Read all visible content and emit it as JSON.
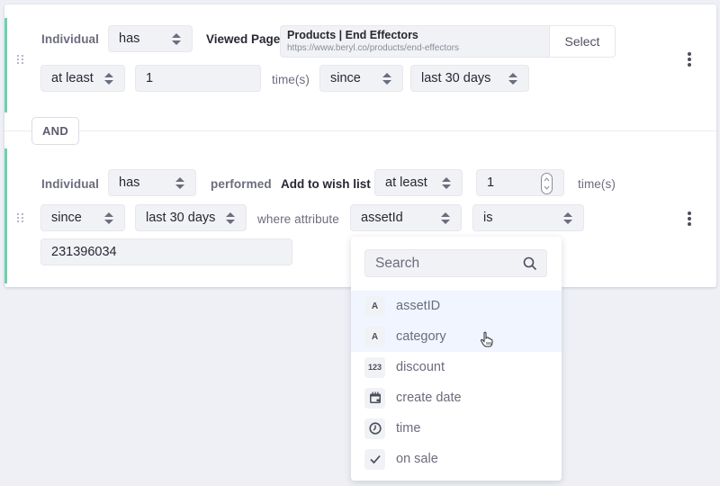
{
  "rule1": {
    "subject": "Individual",
    "verb_select": "has",
    "action_label": "Viewed Page",
    "page": {
      "title": "Products | End Effectors",
      "url": "https://www.beryl.co/products/end-effectors",
      "select_label": "Select"
    },
    "frequency_select": "at least",
    "count_value": "1",
    "times_label": "time(s)",
    "since_select": "since",
    "range_select": "last 30 days"
  },
  "connector": {
    "label": "AND"
  },
  "rule2": {
    "subject": "Individual",
    "verb_select": "has",
    "performed_label": "performed",
    "event_label": "Add to wish list",
    "frequency_select": "at least",
    "count_value": "1",
    "times_label": "time(s)",
    "since_select": "since",
    "range_select": "last 30 days",
    "where_label": "where attribute",
    "attribute_select": "assetId",
    "operator_select": "is",
    "value": "231396034"
  },
  "attribute_dropdown": {
    "search_placeholder": "Search",
    "items": [
      {
        "type_icon": "A",
        "icon": "text-type-icon",
        "label": "assetID",
        "highlighted": true
      },
      {
        "type_icon": "A",
        "icon": "text-type-icon",
        "label": "category",
        "highlighted": true
      },
      {
        "type_icon": "123",
        "icon": "number-type-icon",
        "label": "discount",
        "highlighted": false
      },
      {
        "type_icon": "",
        "icon": "calendar-icon",
        "label": "create date",
        "highlighted": false
      },
      {
        "type_icon": "",
        "icon": "clock-icon",
        "label": "time",
        "highlighted": false
      },
      {
        "type_icon": "",
        "icon": "checkmark-icon",
        "label": "on sale",
        "highlighted": false
      }
    ]
  },
  "colors": {
    "accent": "#6ad3ab",
    "highlight": "#f0f5ff",
    "background": "#eef0f5"
  }
}
